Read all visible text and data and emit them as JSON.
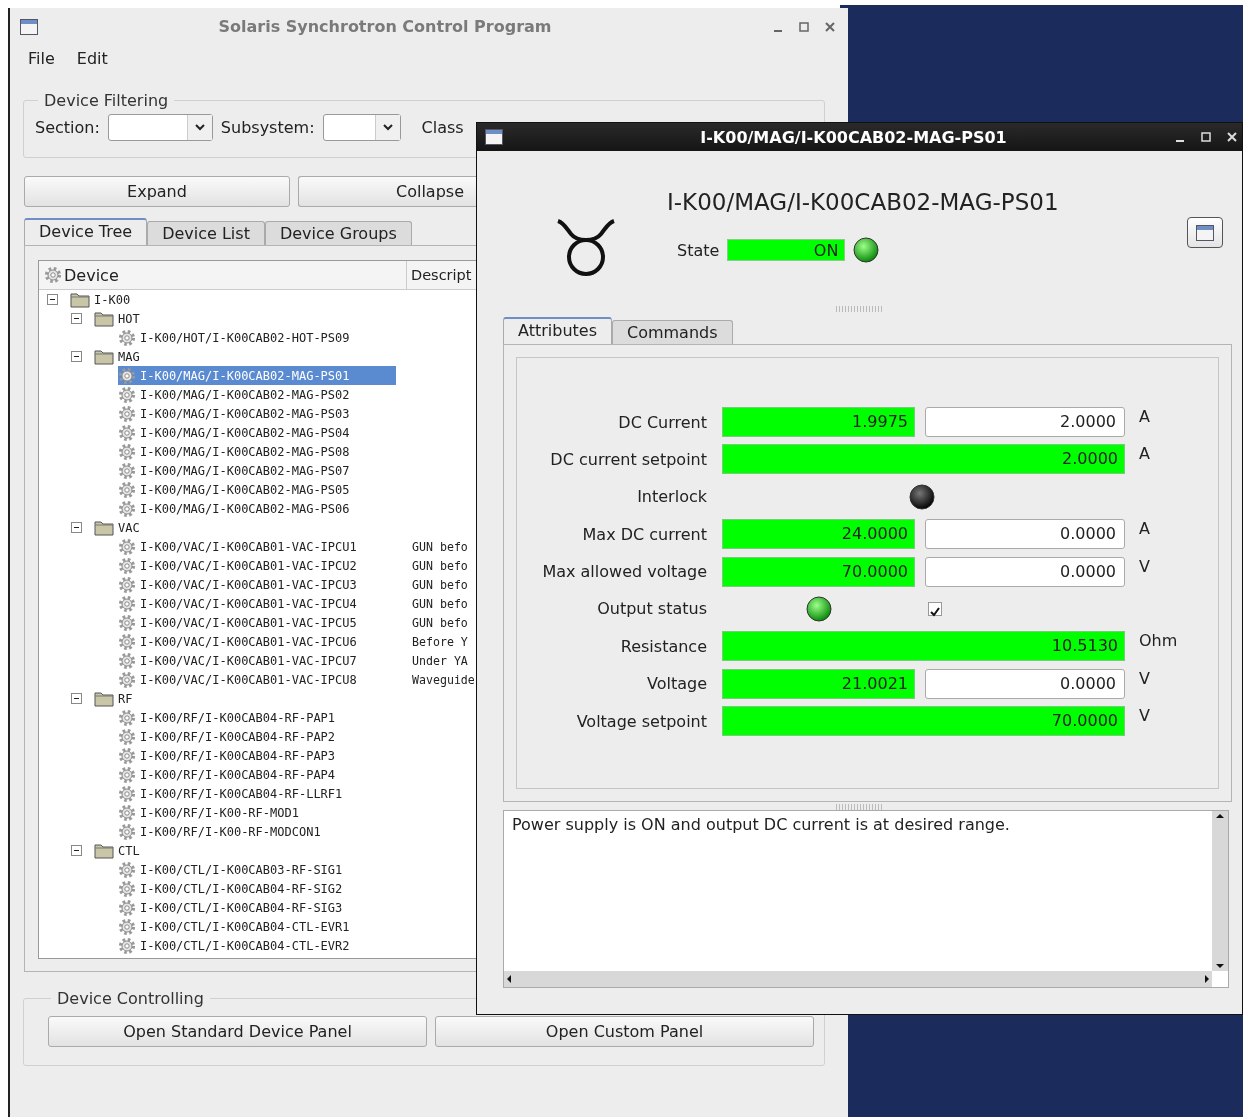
{
  "main_window": {
    "title": "Solaris Synchrotron Control Program",
    "menu": [
      "File",
      "Edit"
    ],
    "device_filtering": {
      "title": "Device Filtering",
      "section_label": "Section:",
      "subsystem_label": "Subsystem:",
      "class_label": "Class"
    },
    "buttons": [
      "Expand",
      "Collapse"
    ],
    "tabs": [
      {
        "label": "Device Tree",
        "selected": true
      },
      {
        "label": "Device List",
        "selected": false
      },
      {
        "label": "Device Groups",
        "selected": false
      }
    ],
    "tree": {
      "columns": [
        "Device",
        "Descript"
      ],
      "items": [
        {
          "kind": "folder",
          "label": "I-K00",
          "expanded": true,
          "children": [
            {
              "kind": "folder",
              "label": "HOT",
              "expanded": true,
              "children": [
                {
                  "kind": "device",
                  "label": "I-K00/HOT/I-K00CAB02-HOT-PS09",
                  "selected": false
                }
              ]
            },
            {
              "kind": "folder",
              "label": "MAG",
              "expanded": true,
              "children": [
                {
                  "kind": "device",
                  "label": "I-K00/MAG/I-K00CAB02-MAG-PS01",
                  "selected": true
                },
                {
                  "kind": "device",
                  "label": "I-K00/MAG/I-K00CAB02-MAG-PS02",
                  "selected": false
                },
                {
                  "kind": "device",
                  "label": "I-K00/MAG/I-K00CAB02-MAG-PS03",
                  "selected": false
                },
                {
                  "kind": "device",
                  "label": "I-K00/MAG/I-K00CAB02-MAG-PS04",
                  "selected": false
                },
                {
                  "kind": "device",
                  "label": "I-K00/MAG/I-K00CAB02-MAG-PS08",
                  "selected": false
                },
                {
                  "kind": "device",
                  "label": "I-K00/MAG/I-K00CAB02-MAG-PS07",
                  "selected": false
                },
                {
                  "kind": "device",
                  "label": "I-K00/MAG/I-K00CAB02-MAG-PS05",
                  "selected": false
                },
                {
                  "kind": "device",
                  "label": "I-K00/MAG/I-K00CAB02-MAG-PS06",
                  "selected": false
                }
              ]
            },
            {
              "kind": "folder",
              "label": "VAC",
              "expanded": true,
              "children": [
                {
                  "kind": "device",
                  "label": "I-K00/VAC/I-K00CAB01-VAC-IPCU1",
                  "description": "GUN befo",
                  "selected": false
                },
                {
                  "kind": "device",
                  "label": "I-K00/VAC/I-K00CAB01-VAC-IPCU2",
                  "description": "GUN befo",
                  "selected": false
                },
                {
                  "kind": "device",
                  "label": "I-K00/VAC/I-K00CAB01-VAC-IPCU3",
                  "description": "GUN befo",
                  "selected": false
                },
                {
                  "kind": "device",
                  "label": "I-K00/VAC/I-K00CAB01-VAC-IPCU4",
                  "description": "GUN befo",
                  "selected": false
                },
                {
                  "kind": "device",
                  "label": "I-K00/VAC/I-K00CAB01-VAC-IPCU5",
                  "description": "GUN befo",
                  "selected": false
                },
                {
                  "kind": "device",
                  "label": "I-K00/VAC/I-K00CAB01-VAC-IPCU6",
                  "description": "Before Y",
                  "selected": false
                },
                {
                  "kind": "device",
                  "label": "I-K00/VAC/I-K00CAB01-VAC-IPCU7",
                  "description": "Under YA",
                  "selected": false
                },
                {
                  "kind": "device",
                  "label": "I-K00/VAC/I-K00CAB01-VAC-IPCU8",
                  "description": "Waveguide",
                  "selected": false
                }
              ]
            },
            {
              "kind": "folder",
              "label": "RF",
              "expanded": true,
              "children": [
                {
                  "kind": "device",
                  "label": "I-K00/RF/I-K00CAB04-RF-PAP1",
                  "selected": false
                },
                {
                  "kind": "device",
                  "label": "I-K00/RF/I-K00CAB04-RF-PAP2",
                  "selected": false
                },
                {
                  "kind": "device",
                  "label": "I-K00/RF/I-K00CAB04-RF-PAP3",
                  "selected": false
                },
                {
                  "kind": "device",
                  "label": "I-K00/RF/I-K00CAB04-RF-PAP4",
                  "selected": false
                },
                {
                  "kind": "device",
                  "label": "I-K00/RF/I-K00CAB04-RF-LLRF1",
                  "selected": false
                },
                {
                  "kind": "device",
                  "label": "I-K00/RF/I-K00-RF-MOD1",
                  "selected": false
                },
                {
                  "kind": "device",
                  "label": "I-K00/RF/I-K00-RF-MODCON1",
                  "selected": false
                }
              ]
            },
            {
              "kind": "folder",
              "label": "CTL",
              "expanded": true,
              "children": [
                {
                  "kind": "device",
                  "label": "I-K00/CTL/I-K00CAB03-RF-SIG1",
                  "selected": false
                },
                {
                  "kind": "device",
                  "label": "I-K00/CTL/I-K00CAB04-RF-SIG2",
                  "selected": false
                },
                {
                  "kind": "device",
                  "label": "I-K00/CTL/I-K00CAB04-RF-SIG3",
                  "selected": false
                },
                {
                  "kind": "device",
                  "label": "I-K00/CTL/I-K00CAB04-CTL-EVR1",
                  "selected": false
                },
                {
                  "kind": "device",
                  "label": "I-K00/CTL/I-K00CAB04-CTL-EVR2",
                  "selected": false
                }
              ]
            }
          ]
        }
      ]
    },
    "device_controlling": {
      "title": "Device Controlling",
      "buttons": [
        "Open Standard Device Panel",
        "Open Custom Panel"
      ]
    }
  },
  "device_window": {
    "title": "I-K00/MAG/I-K00CAB02-MAG-PS01",
    "device_name": "I-K00/MAG/I-K00CAB02-MAG-PS01",
    "state": {
      "label": "State",
      "value": "ON",
      "on": true
    },
    "tabs": [
      {
        "label": "Attributes",
        "selected": true
      },
      {
        "label": "Commands",
        "selected": false
      }
    ],
    "attributes": [
      {
        "kind": "read_write",
        "label": "DC Current",
        "value": "1.9975",
        "setpoint": "2.0000",
        "unit": "A"
      },
      {
        "kind": "read",
        "label": "DC current setpoint",
        "value": "2.0000",
        "unit": "A"
      },
      {
        "kind": "led",
        "label": "Interlock",
        "on": false
      },
      {
        "kind": "read_write",
        "label": "Max DC current",
        "value": "24.0000",
        "setpoint": "0.0000",
        "unit": "A"
      },
      {
        "kind": "read_write",
        "label": "Max allowed voltage",
        "value": "70.0000",
        "setpoint": "0.0000",
        "unit": "V"
      },
      {
        "kind": "led_check",
        "label": "Output status",
        "on": true,
        "checked": true
      },
      {
        "kind": "read",
        "label": "Resistance",
        "value": "10.5130",
        "unit": "Ohm"
      },
      {
        "kind": "read_write",
        "label": "Voltage",
        "value": "21.0021",
        "setpoint": "0.0000",
        "unit": "V"
      },
      {
        "kind": "read",
        "label": "Voltage setpoint",
        "value": "70.0000",
        "unit": "V"
      }
    ],
    "status_text": "Power supply is ON and output DC current is at desired range."
  }
}
